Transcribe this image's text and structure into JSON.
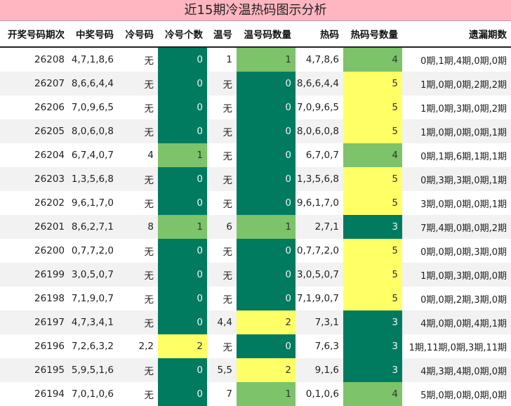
{
  "title": "近15期冷温热码图示分析",
  "headers": [
    "开奖号码期次",
    "中奖号码",
    "冷号码",
    "冷号个数",
    "温号",
    "温号码数量",
    "热码",
    "热码号数量",
    "遗漏期数"
  ],
  "rows": [
    {
      "period": "26208",
      "winning": "4,7,1,8,6",
      "cold": "无",
      "cold_count": "0",
      "warm": "1",
      "warm_count": "1",
      "hot": "4,7,8,6",
      "hot_count": "4",
      "missing": "0期,1期,4期,0期,0期"
    },
    {
      "period": "26207",
      "winning": "8,6,6,4,4",
      "cold": "无",
      "cold_count": "0",
      "warm": "无",
      "warm_count": "0",
      "hot": "8,6,6,4,4",
      "hot_count": "5",
      "missing": "1期,0期,0期,2期,2期"
    },
    {
      "period": "26206",
      "winning": "7,0,9,6,5",
      "cold": "无",
      "cold_count": "0",
      "warm": "无",
      "warm_count": "0",
      "hot": "7,0,9,6,5",
      "hot_count": "5",
      "missing": "1期,0期,3期,0期,2期"
    },
    {
      "period": "26205",
      "winning": "8,0,6,0,8",
      "cold": "无",
      "cold_count": "0",
      "warm": "无",
      "warm_count": "0",
      "hot": "8,0,6,0,8",
      "hot_count": "5",
      "missing": "1期,0期,0期,0期,1期"
    },
    {
      "period": "26204",
      "winning": "6,7,4,0,7",
      "cold": "4",
      "cold_count": "1",
      "warm": "无",
      "warm_count": "0",
      "hot": "6,7,0,7",
      "hot_count": "4",
      "missing": "0期,1期,6期,1期,1期"
    },
    {
      "period": "26203",
      "winning": "1,3,5,6,8",
      "cold": "无",
      "cold_count": "0",
      "warm": "无",
      "warm_count": "0",
      "hot": "1,3,5,6,8",
      "hot_count": "5",
      "missing": "0期,3期,3期,0期,1期"
    },
    {
      "period": "26202",
      "winning": "9,6,1,7,0",
      "cold": "无",
      "cold_count": "0",
      "warm": "无",
      "warm_count": "0",
      "hot": "9,6,1,7,0",
      "hot_count": "5",
      "missing": "3期,0期,0期,0期,1期"
    },
    {
      "period": "26201",
      "winning": "8,6,2,7,1",
      "cold": "8",
      "cold_count": "1",
      "warm": "6",
      "warm_count": "1",
      "hot": "2,7,1",
      "hot_count": "3",
      "missing": "7期,4期,0期,0期,2期"
    },
    {
      "period": "26200",
      "winning": "0,7,7,2,0",
      "cold": "无",
      "cold_count": "0",
      "warm": "无",
      "warm_count": "0",
      "hot": "0,7,7,2,0",
      "hot_count": "5",
      "missing": "0期,0期,0期,3期,0期"
    },
    {
      "period": "26199",
      "winning": "3,0,5,0,7",
      "cold": "无",
      "cold_count": "0",
      "warm": "无",
      "warm_count": "0",
      "hot": "3,0,5,0,7",
      "hot_count": "5",
      "missing": "1期,0期,3期,0期,0期"
    },
    {
      "period": "26198",
      "winning": "7,1,9,0,7",
      "cold": "无",
      "cold_count": "0",
      "warm": "无",
      "warm_count": "0",
      "hot": "7,1,9,0,7",
      "hot_count": "5",
      "missing": "0期,0期,2期,3期,0期"
    },
    {
      "period": "26197",
      "winning": "4,7,3,4,1",
      "cold": "无",
      "cold_count": "0",
      "warm": "4,4",
      "warm_count": "2",
      "hot": "7,3,1",
      "hot_count": "3",
      "missing": "4期,0期,0期,4期,1期"
    },
    {
      "period": "26196",
      "winning": "7,2,6,3,2",
      "cold": "2,2",
      "cold_count": "2",
      "warm": "无",
      "warm_count": "0",
      "hot": "7,6,3",
      "hot_count": "3",
      "missing": "1期,11期,0期,3期,11期"
    },
    {
      "period": "26195",
      "winning": "5,9,5,1,6",
      "cold": "无",
      "cold_count": "0",
      "warm": "5,5",
      "warm_count": "2",
      "hot": "9,1,6",
      "hot_count": "3",
      "missing": "4期,3期,4期,0期,0期"
    },
    {
      "period": "26194",
      "winning": "7,0,1,0,6",
      "cold": "无",
      "cold_count": "0",
      "warm": "7",
      "warm_count": "1",
      "hot": "0,1,0,6",
      "hot_count": "4",
      "missing": "5期,0期,0期,0期,0期"
    }
  ],
  "colors": {
    "title_bg": "#ffb6c1",
    "count_zero": "#007b5f",
    "count_one": "#7cc36a",
    "count_two": "#ffff66",
    "hot_three": "#007b5f",
    "hot_four": "#7cc36a",
    "hot_five": "#ffff66"
  }
}
